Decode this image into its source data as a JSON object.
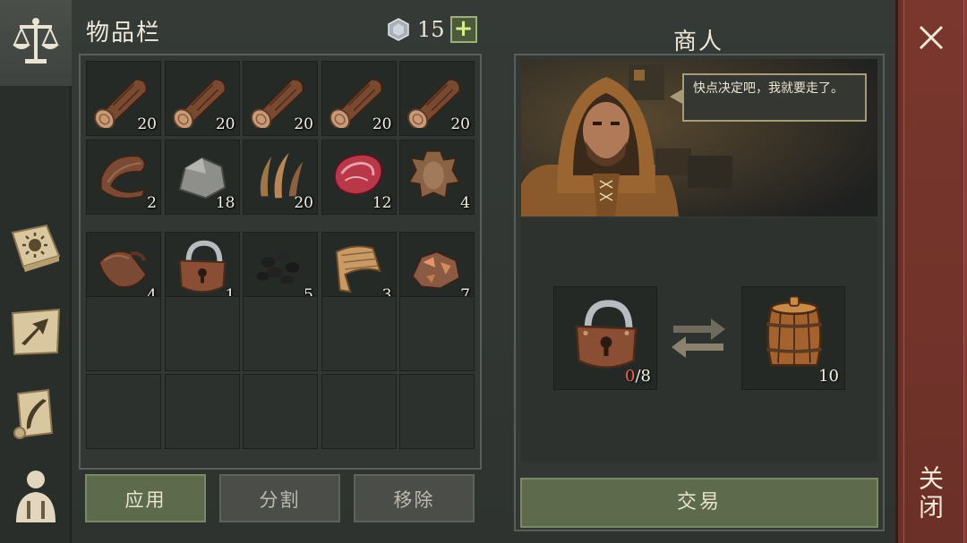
{
  "inventory": {
    "title": "物品栏",
    "currency_value": "15",
    "currency_plus": "+",
    "slots": [
      {
        "icon": "log-icon",
        "count": "20"
      },
      {
        "icon": "log-icon",
        "count": "20"
      },
      {
        "icon": "log-icon",
        "count": "20"
      },
      {
        "icon": "log-icon",
        "count": "20"
      },
      {
        "icon": "log-icon",
        "count": "20"
      },
      {
        "icon": "leather-strap-icon",
        "count": "2"
      },
      {
        "icon": "stone-icon",
        "count": "18"
      },
      {
        "icon": "fiber-icon",
        "count": "20"
      },
      {
        "icon": "raw-meat-icon",
        "count": "12"
      },
      {
        "icon": "animal-hide-icon",
        "count": "4"
      },
      {
        "icon": "leather-icon",
        "count": "4"
      },
      {
        "icon": "padlock-icon",
        "count": "1"
      },
      {
        "icon": "coal-icon",
        "count": "5"
      },
      {
        "icon": "cloth-icon",
        "count": "3"
      },
      {
        "icon": "copper-ore-icon",
        "count": "7"
      }
    ]
  },
  "buttons": {
    "apply": "应用",
    "split": "分割",
    "remove": "移除",
    "trade": "交易"
  },
  "merchant": {
    "title": "商人",
    "speech": "快点决定吧，我就要走了。",
    "offer_item": {
      "icon": "padlock-icon",
      "have": "0",
      "need": "/8"
    },
    "receive_item": {
      "icon": "wooden-barrel-icon",
      "count": "10"
    }
  },
  "close": {
    "label": "关闭"
  },
  "colors": {
    "accent_green": "#5d6b4c",
    "close_red": "#7a372d",
    "insufficient_red": "#e8695a"
  }
}
